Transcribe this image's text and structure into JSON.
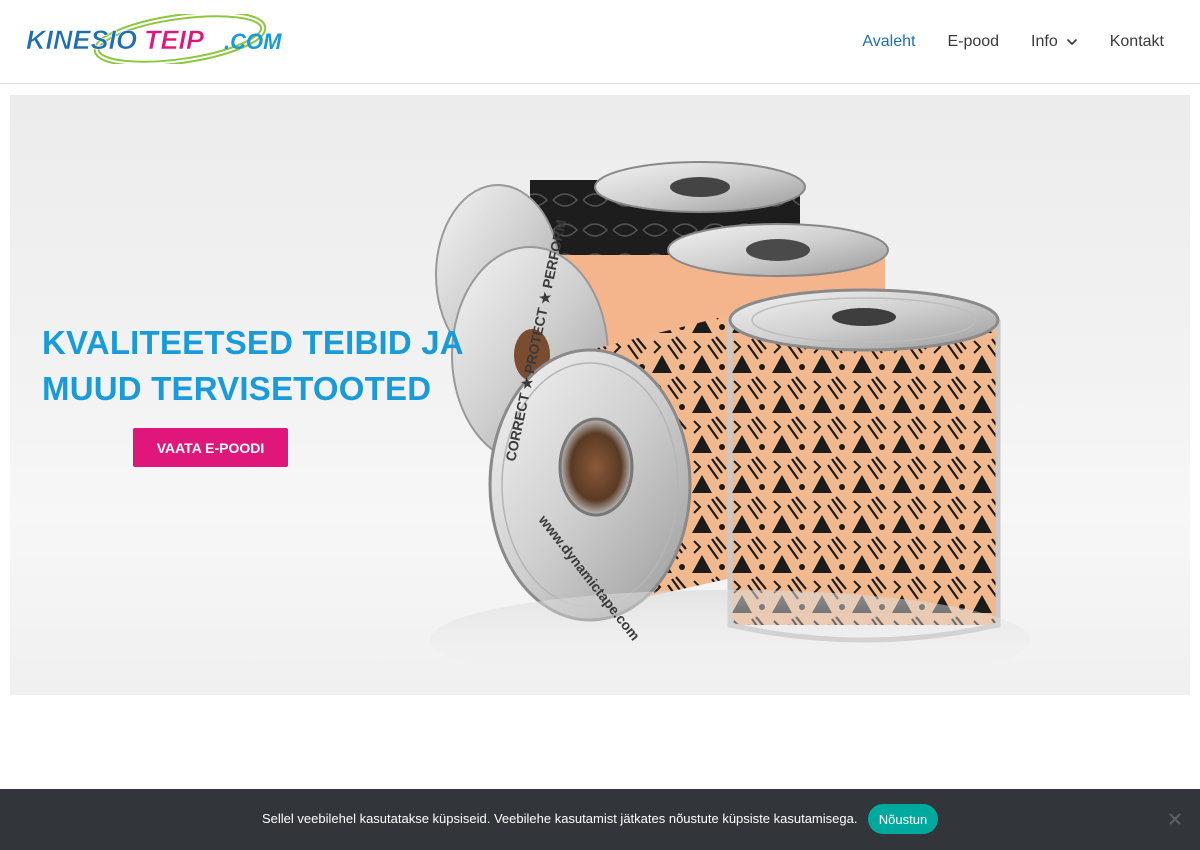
{
  "header": {
    "logo_alt": "KINESIOTEIP.COM",
    "logo_parts": {
      "kinesio": "KINESIO",
      "teip": "TEIP",
      "com": ".COM"
    },
    "nav": [
      {
        "label": "Avaleht",
        "active": true
      },
      {
        "label": "E-pood",
        "active": false
      },
      {
        "label": "Info",
        "active": false,
        "has_dropdown": true
      },
      {
        "label": "Kontakt",
        "active": false
      }
    ]
  },
  "hero": {
    "title": "KVALITEETSED TEIBID JA MUUD TERVISETOOTED",
    "button_label": "VAATA E-POODI",
    "image_text": {
      "spool_ring": "CORRECT ★ PROTECT ★ PERFORM",
      "spool_url": "www.dynamictape.com"
    }
  },
  "cookie_bar": {
    "text": "Sellel veebilehel kasutatakse küpsiseid. Veebilehe kasutamist jätkates nõustute küpsiste kasutamisega.",
    "accept_label": "Nõustun",
    "close_icon": "close-icon"
  },
  "colors": {
    "nav_active": "#1e6eb3",
    "hero_title": "#1a9bd9",
    "cta": "#e0177b",
    "cookie_bg": "#32353a",
    "cookie_accept": "#00a99d"
  }
}
